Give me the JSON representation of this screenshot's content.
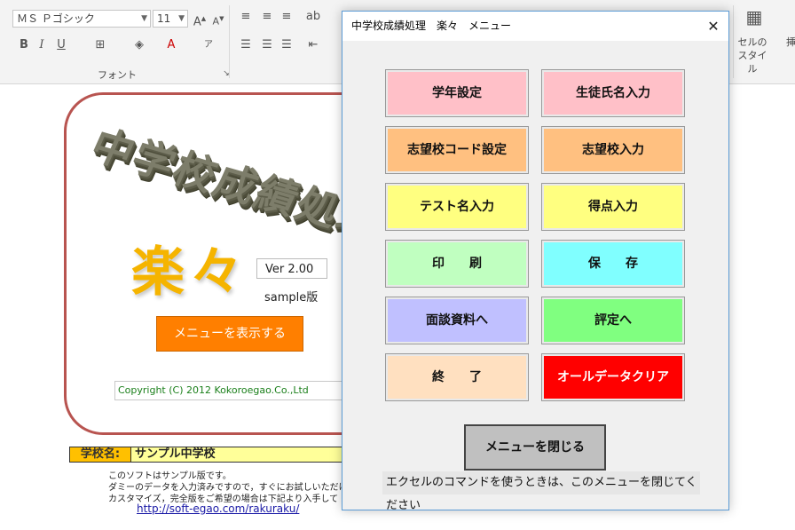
{
  "ribbon": {
    "font_name": "ＭＳ Ｐゴシック",
    "font_size": "11",
    "group_label": "フォント",
    "cell_style_label": "セルの\nスタイル",
    "insert_label": "挿"
  },
  "splash": {
    "big_title": "中学校成績処理",
    "app_name": "楽々",
    "version": "Ver  2.00",
    "edition": "sample版",
    "show_menu_button": "メニューを表示する",
    "copyright": "Copyright (C) 2012 Kokoroegao.Co.,Ltd"
  },
  "school": {
    "label": "学校名:",
    "name": "サンプル中学校"
  },
  "notes": [
    "このソフトはサンプル版です。",
    "ダミーのデータを入力済みですので，すぐにお試しいただけ",
    "カスタマイズ，完全版をご希望の場合は下記より入手して"
  ],
  "url": "http://soft-egao.com/rakuraku/",
  "dialog": {
    "title": "中学校成績処理　楽々　メニュー",
    "buttons": [
      {
        "label": "学年設定",
        "color": "#ffc0c8"
      },
      {
        "label": "生徒氏名入力",
        "color": "#ffc0c8"
      },
      {
        "label": "志望校コード設定",
        "color": "#ffc080"
      },
      {
        "label": "志望校入力",
        "color": "#ffc080"
      },
      {
        "label": "テスト名入力",
        "color": "#ffff80"
      },
      {
        "label": "得点入力",
        "color": "#ffff80"
      },
      {
        "label": "印　　刷",
        "color": "#c0ffc0"
      },
      {
        "label": "保　　存",
        "color": "#80ffff"
      },
      {
        "label": "面談資料へ",
        "color": "#c0c0ff"
      },
      {
        "label": "評定へ",
        "color": "#80ff80"
      },
      {
        "label": "終　　了",
        "color": "#ffe0c0"
      },
      {
        "label": "オールデータクリア",
        "color": "#ff0000"
      }
    ],
    "close_button": "メニューを閉じる",
    "hint": "エクセルのコマンドを使うときは、このメニューを閉じてください"
  }
}
